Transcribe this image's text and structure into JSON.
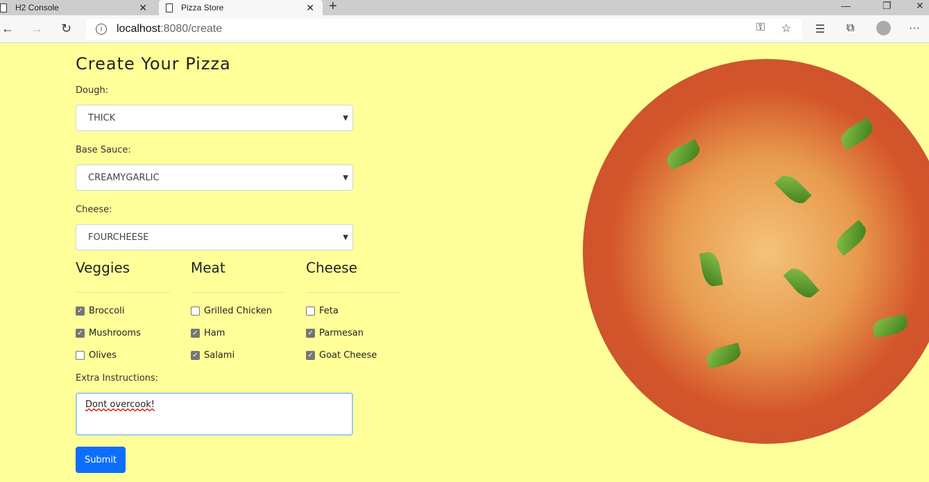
{
  "browser": {
    "tabs": [
      {
        "title": "H2 Console"
      },
      {
        "title": "Pizza Store"
      }
    ],
    "url_host": "localhost",
    "url_path": ":8080/create"
  },
  "page": {
    "title": "Create Your Pizza",
    "dough": {
      "label": "Dough:",
      "value": "THICK"
    },
    "sauce": {
      "label": "Base Sauce:",
      "value": "CREAMYGARLIC"
    },
    "cheese": {
      "label": "Cheese:",
      "value": "FOURCHEESE"
    },
    "groups": [
      {
        "title": "Veggies",
        "items": [
          {
            "label": "Broccoli",
            "checked": true
          },
          {
            "label": "Mushrooms",
            "checked": true
          },
          {
            "label": "Olives",
            "checked": false
          }
        ]
      },
      {
        "title": "Meat",
        "items": [
          {
            "label": "Grilled Chicken",
            "checked": false
          },
          {
            "label": "Ham",
            "checked": true
          },
          {
            "label": "Salami",
            "checked": true
          }
        ]
      },
      {
        "title": "Cheese",
        "items": [
          {
            "label": "Feta",
            "checked": false
          },
          {
            "label": "Parmesan",
            "checked": true
          },
          {
            "label": "Goat Cheese",
            "checked": true
          }
        ]
      }
    ],
    "extra": {
      "label": "Extra Instructions:",
      "value": "Dont overcook!"
    },
    "submit": "Submit"
  },
  "colors": {
    "background": "#ffff99",
    "primary": "#0d6efd"
  }
}
